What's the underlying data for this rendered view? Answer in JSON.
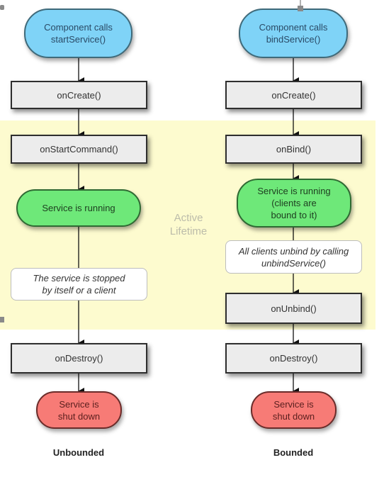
{
  "region_label": "Active\nLifetime",
  "columns": {
    "unbounded": {
      "label": "Unbounded",
      "start": "Component calls\nstartService()",
      "create": "onCreate()",
      "command": "onStartCommand()",
      "running": "Service is running",
      "stop_note": "The service is stopped\nby itself or a client",
      "destroy": "onDestroy()",
      "shutdown": "Service is\nshut down"
    },
    "bounded": {
      "label": "Bounded",
      "start": "Component calls\nbindService()",
      "create": "onCreate()",
      "bind": "onBind()",
      "running": "Service is running\n(clients are\nbound to it)",
      "unbind_note": "All clients unbind by calling\nunbindService()",
      "unbind": "onUnbind()",
      "destroy": "onDestroy()",
      "shutdown": "Service is\nshut down"
    }
  },
  "colors": {
    "start_fill": "#7fd3f7",
    "running_fill": "#6ee879",
    "shutdown_fill": "#f77b76",
    "method_fill": "#ececec",
    "active_region": "#fdfbcf"
  }
}
